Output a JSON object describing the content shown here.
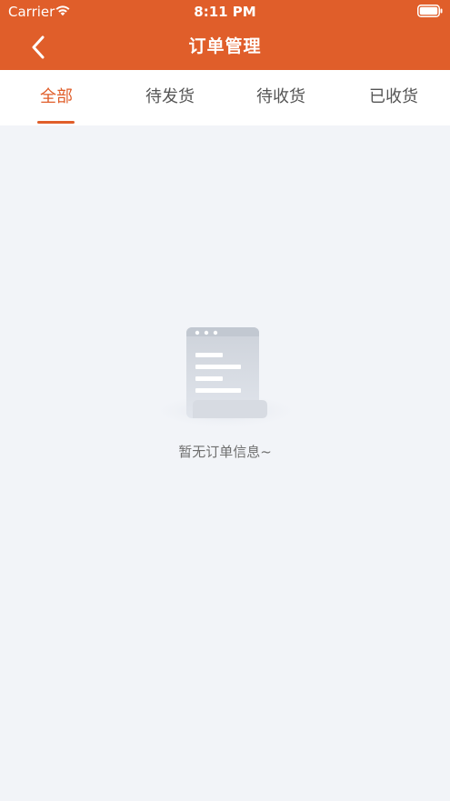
{
  "status_bar": {
    "carrier": "Carrier",
    "time": "8:11 PM"
  },
  "header": {
    "title": "订单管理",
    "background_color": "#e05e2a"
  },
  "tabs": [
    {
      "label": "全部",
      "active": true
    },
    {
      "label": "待发货",
      "active": false
    },
    {
      "label": "待收货",
      "active": false
    },
    {
      "label": "已收货",
      "active": false
    }
  ],
  "accent_color": "#e05e2a",
  "empty_state": {
    "message": "暂无订单信息~",
    "icon": "empty-order-document-icon"
  }
}
